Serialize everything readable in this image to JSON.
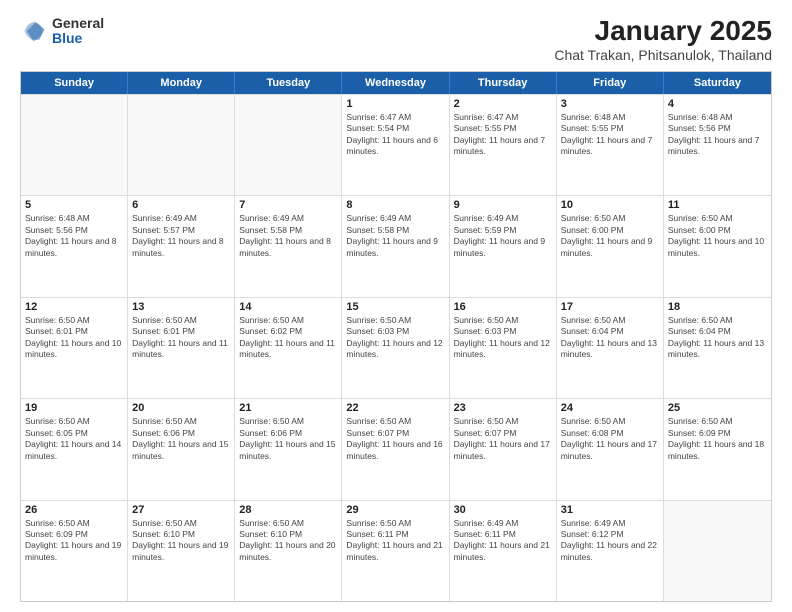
{
  "header": {
    "logo_general": "General",
    "logo_blue": "Blue",
    "title": "January 2025",
    "subtitle": "Chat Trakan, Phitsanulok, Thailand"
  },
  "days_of_week": [
    "Sunday",
    "Monday",
    "Tuesday",
    "Wednesday",
    "Thursday",
    "Friday",
    "Saturday"
  ],
  "weeks": [
    [
      {
        "day": "",
        "empty": true
      },
      {
        "day": "",
        "empty": true
      },
      {
        "day": "",
        "empty": true
      },
      {
        "day": "1",
        "sunrise": "6:47 AM",
        "sunset": "5:54 PM",
        "daylight": "11 hours and 6 minutes."
      },
      {
        "day": "2",
        "sunrise": "6:47 AM",
        "sunset": "5:55 PM",
        "daylight": "11 hours and 7 minutes."
      },
      {
        "day": "3",
        "sunrise": "6:48 AM",
        "sunset": "5:55 PM",
        "daylight": "11 hours and 7 minutes."
      },
      {
        "day": "4",
        "sunrise": "6:48 AM",
        "sunset": "5:56 PM",
        "daylight": "11 hours and 7 minutes."
      }
    ],
    [
      {
        "day": "5",
        "sunrise": "6:48 AM",
        "sunset": "5:56 PM",
        "daylight": "11 hours and 8 minutes."
      },
      {
        "day": "6",
        "sunrise": "6:49 AM",
        "sunset": "5:57 PM",
        "daylight": "11 hours and 8 minutes."
      },
      {
        "day": "7",
        "sunrise": "6:49 AM",
        "sunset": "5:58 PM",
        "daylight": "11 hours and 8 minutes."
      },
      {
        "day": "8",
        "sunrise": "6:49 AM",
        "sunset": "5:58 PM",
        "daylight": "11 hours and 9 minutes."
      },
      {
        "day": "9",
        "sunrise": "6:49 AM",
        "sunset": "5:59 PM",
        "daylight": "11 hours and 9 minutes."
      },
      {
        "day": "10",
        "sunrise": "6:50 AM",
        "sunset": "6:00 PM",
        "daylight": "11 hours and 9 minutes."
      },
      {
        "day": "11",
        "sunrise": "6:50 AM",
        "sunset": "6:00 PM",
        "daylight": "11 hours and 10 minutes."
      }
    ],
    [
      {
        "day": "12",
        "sunrise": "6:50 AM",
        "sunset": "6:01 PM",
        "daylight": "11 hours and 10 minutes."
      },
      {
        "day": "13",
        "sunrise": "6:50 AM",
        "sunset": "6:01 PM",
        "daylight": "11 hours and 11 minutes."
      },
      {
        "day": "14",
        "sunrise": "6:50 AM",
        "sunset": "6:02 PM",
        "daylight": "11 hours and 11 minutes."
      },
      {
        "day": "15",
        "sunrise": "6:50 AM",
        "sunset": "6:03 PM",
        "daylight": "11 hours and 12 minutes."
      },
      {
        "day": "16",
        "sunrise": "6:50 AM",
        "sunset": "6:03 PM",
        "daylight": "11 hours and 12 minutes."
      },
      {
        "day": "17",
        "sunrise": "6:50 AM",
        "sunset": "6:04 PM",
        "daylight": "11 hours and 13 minutes."
      },
      {
        "day": "18",
        "sunrise": "6:50 AM",
        "sunset": "6:04 PM",
        "daylight": "11 hours and 13 minutes."
      }
    ],
    [
      {
        "day": "19",
        "sunrise": "6:50 AM",
        "sunset": "6:05 PM",
        "daylight": "11 hours and 14 minutes."
      },
      {
        "day": "20",
        "sunrise": "6:50 AM",
        "sunset": "6:06 PM",
        "daylight": "11 hours and 15 minutes."
      },
      {
        "day": "21",
        "sunrise": "6:50 AM",
        "sunset": "6:06 PM",
        "daylight": "11 hours and 15 minutes."
      },
      {
        "day": "22",
        "sunrise": "6:50 AM",
        "sunset": "6:07 PM",
        "daylight": "11 hours and 16 minutes."
      },
      {
        "day": "23",
        "sunrise": "6:50 AM",
        "sunset": "6:07 PM",
        "daylight": "11 hours and 17 minutes."
      },
      {
        "day": "24",
        "sunrise": "6:50 AM",
        "sunset": "6:08 PM",
        "daylight": "11 hours and 17 minutes."
      },
      {
        "day": "25",
        "sunrise": "6:50 AM",
        "sunset": "6:09 PM",
        "daylight": "11 hours and 18 minutes."
      }
    ],
    [
      {
        "day": "26",
        "sunrise": "6:50 AM",
        "sunset": "6:09 PM",
        "daylight": "11 hours and 19 minutes."
      },
      {
        "day": "27",
        "sunrise": "6:50 AM",
        "sunset": "6:10 PM",
        "daylight": "11 hours and 19 minutes."
      },
      {
        "day": "28",
        "sunrise": "6:50 AM",
        "sunset": "6:10 PM",
        "daylight": "11 hours and 20 minutes."
      },
      {
        "day": "29",
        "sunrise": "6:50 AM",
        "sunset": "6:11 PM",
        "daylight": "11 hours and 21 minutes."
      },
      {
        "day": "30",
        "sunrise": "6:49 AM",
        "sunset": "6:11 PM",
        "daylight": "11 hours and 21 minutes."
      },
      {
        "day": "31",
        "sunrise": "6:49 AM",
        "sunset": "6:12 PM",
        "daylight": "11 hours and 22 minutes."
      },
      {
        "day": "",
        "empty": true
      }
    ]
  ],
  "labels": {
    "sunrise": "Sunrise:",
    "sunset": "Sunset:",
    "daylight": "Daylight:"
  }
}
